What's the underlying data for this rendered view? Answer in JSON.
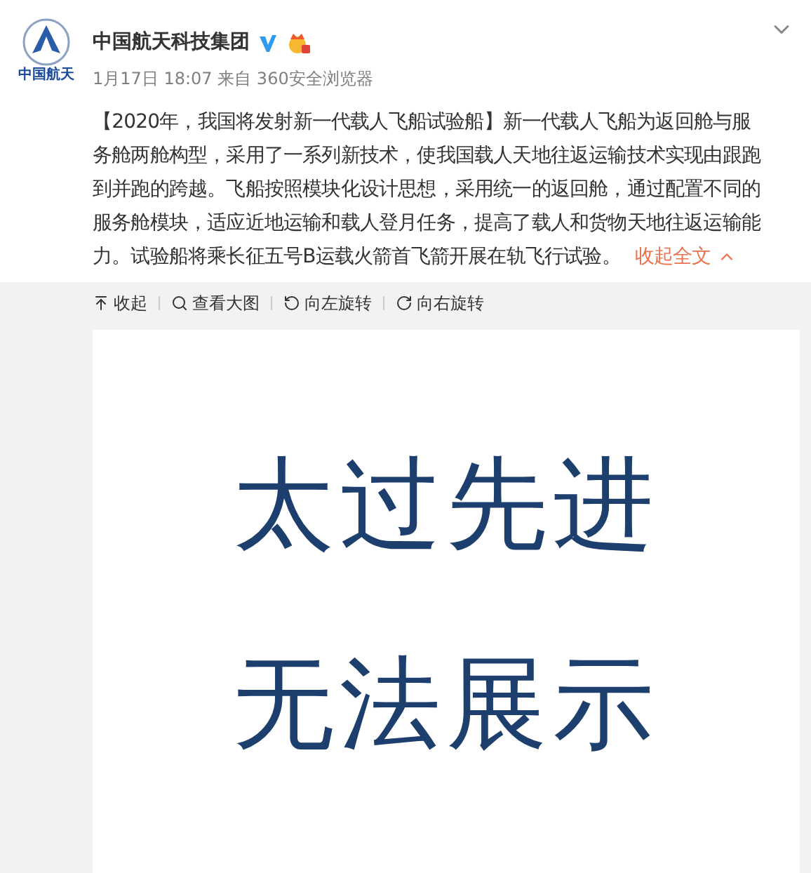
{
  "account": {
    "logo_text": "中国航天",
    "name": "中国航天科技集团",
    "verified": true,
    "meta": "1月17日 18:07 来自 360安全浏览器"
  },
  "post": {
    "text": "【2020年，我国将发射新一代载人飞船试验船】新一代载人飞船为返回舱与服务舱两舱构型，采用了一系列新技术，使我国载人天地往返运输技术实现由跟跑到并跑的跨越。飞船按照模块化设计思想，采用统一的返回舱，通过配置不同的服务舱模块，适应近地运输和载人登月任务，提高了载人和货物天地往返运输能力。试验船将乘长征五号B运载火箭首飞箭开展在轨飞行试验。",
    "collapse_link": "收起全文"
  },
  "media_toolbar": [
    {
      "kind": "collapse",
      "label": "收起"
    },
    {
      "kind": "zoom",
      "label": "查看大图"
    },
    {
      "kind": "rotate_left",
      "label": "向左旋转"
    },
    {
      "kind": "rotate_right",
      "label": "向右旋转"
    }
  ],
  "image_lines": [
    "太过先进",
    "无法展示"
  ]
}
